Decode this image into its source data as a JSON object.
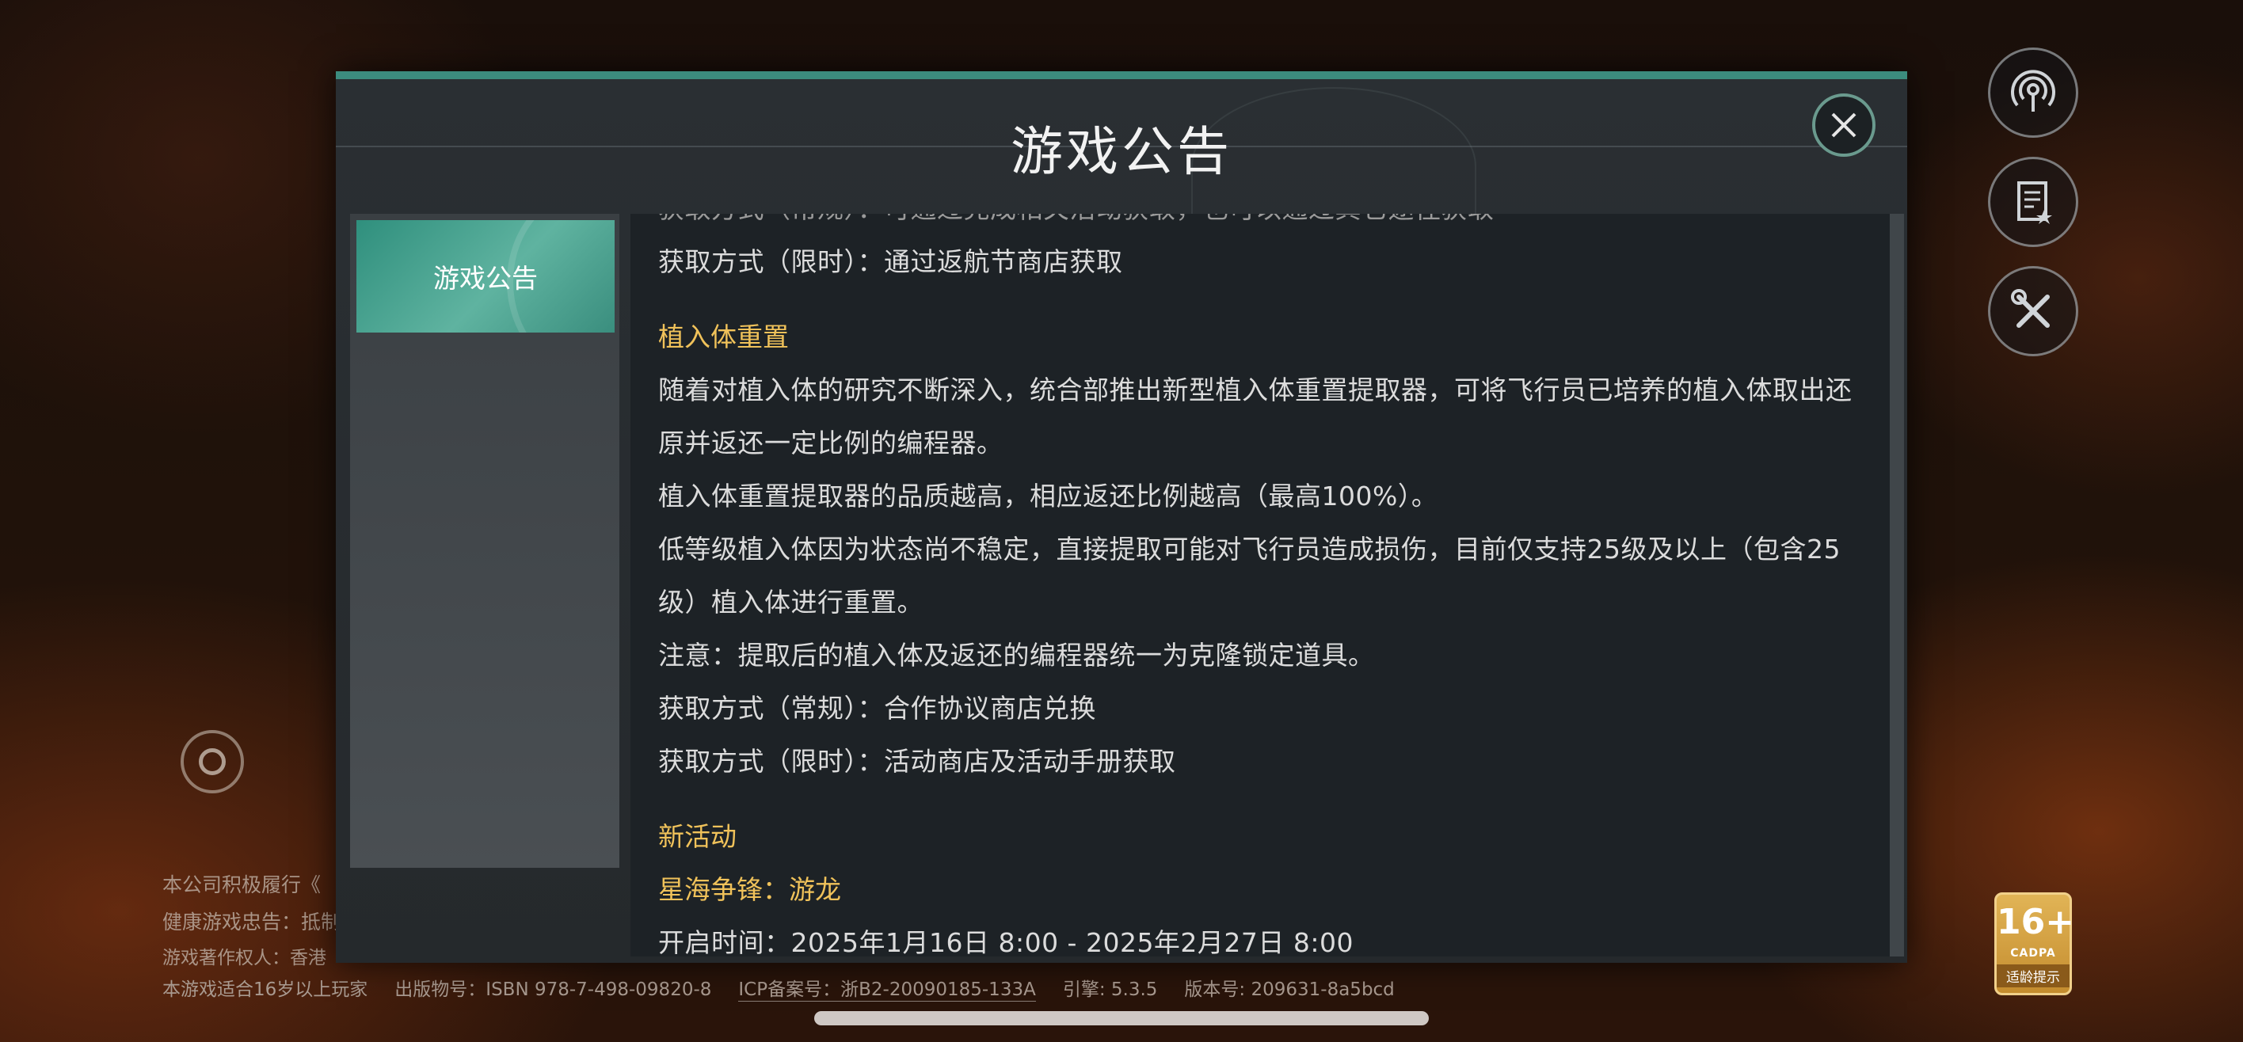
{
  "footer": {
    "line1": "本公司积极履行《",
    "line2": "健康游戏忠告：抵制",
    "line3": "游戏著作权人：香港",
    "age_notice": "本游戏适合16岁以上玩家",
    "publication": "出版物号：ISBN 978-7-498-09820-8",
    "icp": "ICP备案号：浙B2-20090185-133A",
    "engine": "引擎: 5.3.5",
    "version": "版本号: 209631-8a5bcd"
  },
  "age_badge": {
    "age": "16+",
    "org": "CADPA",
    "tip": "适龄提示"
  },
  "side_buttons": {
    "broadcast_icon": "broadcast-icon",
    "notes_icon": "notes-icon",
    "settings_icon": "wrench-screwdriver-icon"
  },
  "modal": {
    "title": "游戏公告",
    "nav_items": [
      {
        "label": "游戏公告",
        "selected": true
      }
    ],
    "content": {
      "cut_line": "获取方式（常规）：可通过完成相关活动获取，也可以通过其它途径获取",
      "line_limited_1": "获取方式（限时）：通过返航节商店获取",
      "section1_title": "植入体重置",
      "section1_p1": "随着对植入体的研究不断深入，统合部推出新型植入体重置提取器，可将飞行员已培养的植入体取出还原并返还一定比例的编程器。",
      "section1_p2": "植入体重置提取器的品质越高，相应返还比例越高（最高100%）。",
      "section1_p3": "低等级植入体因为状态尚不稳定，直接提取可能对飞行员造成损伤，目前仅支持25级及以上（包含25级）植入体进行重置。",
      "section1_p4": "注意：提取后的植入体及返还的编程器统一为克隆锁定道具。",
      "section1_regular": "获取方式（常规）：合作协议商店兑换",
      "section1_limited": "获取方式（限时）：活动商店及活动手册获取",
      "section2_title": "新活动",
      "section2_subtitle": "星海争锋：游龙",
      "section2_time": "开启时间：2025年1月16日 8:00 - 2025年2月27日 8:00"
    }
  },
  "colors": {
    "accent_teal": "#3c8c7e",
    "heading_gold": "#f0c25a",
    "body_text": "#dcdcdc"
  }
}
